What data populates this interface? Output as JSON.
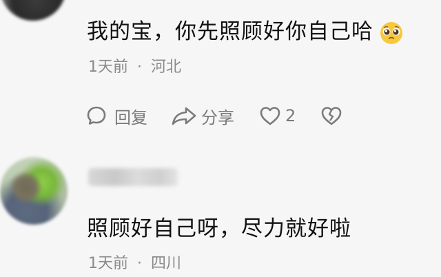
{
  "comments": [
    {
      "text": "我的宝，你先照顾好你自己哈",
      "emoji_icon": "pleading-face-icon",
      "time": "1天前",
      "separator": "·",
      "location": "河北",
      "actions": {
        "reply_label": "回复",
        "share_label": "分享",
        "like_count": "2"
      }
    },
    {
      "text": "照顾好自己呀，尽力就好啦",
      "time": "1天前",
      "separator": "·",
      "location": "四川"
    }
  ],
  "colors": {
    "background": "#f6f6f6",
    "text": "#111111",
    "meta": "#8a8a8a",
    "icon": "#7a7a7a"
  }
}
